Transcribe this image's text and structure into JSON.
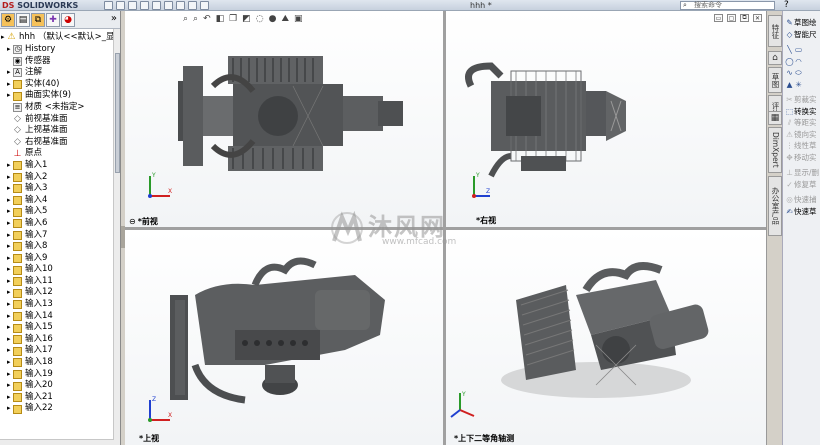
{
  "titlebar": {
    "logo_ds": "DS",
    "logo_app": "SOLIDWORKS",
    "document_title": "hhh *",
    "search_placeholder": "搜索命令",
    "help": "?"
  },
  "feature_tree": {
    "root": "hhh （默认<<默认>_显示状",
    "items": [
      {
        "label": "History",
        "icon": "history-icon"
      },
      {
        "label": "传感器",
        "icon": "sensor-icon"
      },
      {
        "label": "注解",
        "icon": "annotation-icon"
      },
      {
        "label": "实体(40)",
        "icon": "solid-bodies-icon"
      },
      {
        "label": "曲面实体(9)",
        "icon": "surface-bodies-icon"
      },
      {
        "label": "材质 <未指定>",
        "icon": "material-icon"
      },
      {
        "label": "前视基准面",
        "icon": "plane-icon"
      },
      {
        "label": "上视基准面",
        "icon": "plane-icon"
      },
      {
        "label": "右视基准面",
        "icon": "plane-icon"
      },
      {
        "label": "原点",
        "icon": "origin-icon"
      }
    ],
    "imports": [
      "输入1",
      "输入2",
      "输入3",
      "输入4",
      "输入5",
      "输入6",
      "输入7",
      "输入8",
      "输入9",
      "输入10",
      "输入11",
      "输入12",
      "输入13",
      "输入14",
      "输入15",
      "输入16",
      "输入17",
      "输入18",
      "输入19",
      "输入20",
      "输入21",
      "输入22"
    ]
  },
  "viewports": {
    "front_label": "*前视",
    "right_label": "*右视",
    "top_label": "*上视",
    "iso_label": "*上下二等角轴测"
  },
  "watermark": {
    "text": "沐风网",
    "url": "www.mfcad.com"
  },
  "task_tabs": [
    "特征",
    "草图",
    "评估",
    "DimXpert",
    "办公室产品"
  ],
  "right_panel": [
    {
      "label": "草图绘",
      "icon": "sketch-icon",
      "enabled": true
    },
    {
      "label": "智能尺",
      "icon": "smart-dimension-icon",
      "enabled": true
    },
    {
      "label": "剪裁实",
      "icon": "trim-icon",
      "enabled": false
    },
    {
      "label": "转换实",
      "icon": "convert-icon",
      "enabled": true
    },
    {
      "label": "等距实",
      "icon": "offset-icon",
      "enabled": false
    },
    {
      "label": "镜向实",
      "icon": "mirror-icon",
      "enabled": false
    },
    {
      "label": "线性草",
      "icon": "linear-pattern-icon",
      "enabled": false
    },
    {
      "label": "移动实",
      "icon": "move-icon",
      "enabled": false
    },
    {
      "label": "显示/删",
      "icon": "display-relations-icon",
      "enabled": false
    },
    {
      "label": "修复草",
      "icon": "repair-sketch-icon",
      "enabled": false
    },
    {
      "label": "快速捕",
      "icon": "quick-snaps-icon",
      "enabled": false
    },
    {
      "label": "快速草",
      "icon": "rapid-sketch-icon",
      "enabled": true
    }
  ],
  "colors": {
    "accent_red": "#b51c1c",
    "part_yellow": "#f2cf5a",
    "model_gray": "#5a5c5e"
  }
}
